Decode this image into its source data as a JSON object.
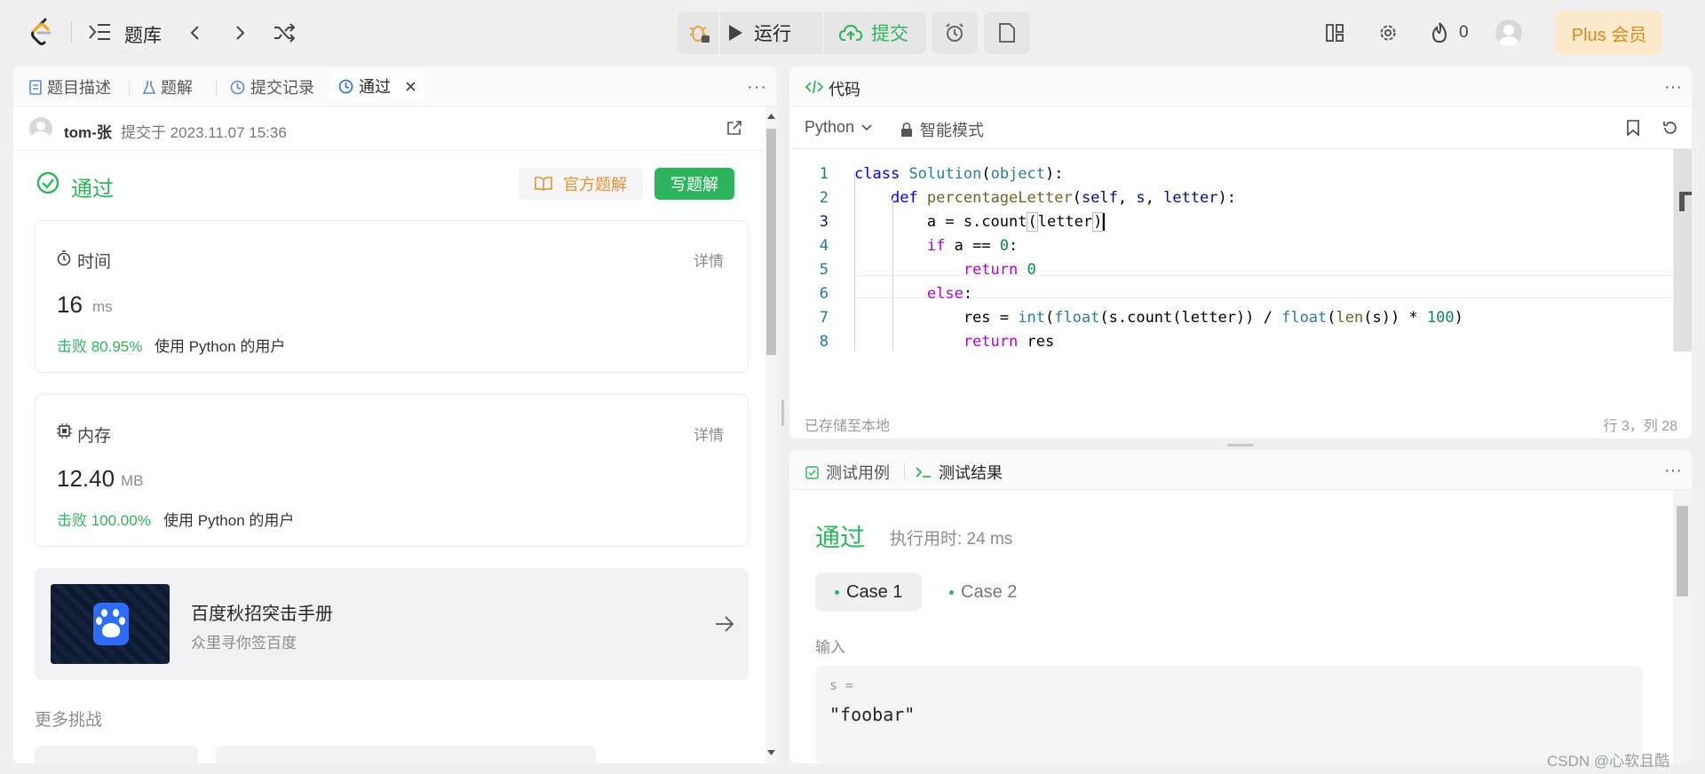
{
  "topbar": {
    "problem_bank": "题库",
    "run_label": "运行",
    "submit_label": "提交",
    "fire_count": "0",
    "plus_label": "Plus 会员"
  },
  "left_tabs": {
    "description": "题目描述",
    "solutions": "题解",
    "submissions": "提交记录",
    "passed": "通过"
  },
  "submission": {
    "user": "tom-张",
    "submitted_at": "提交于 2023.11.07 15:36",
    "status": "通过",
    "official_solution": "官方题解",
    "write_solution": "写题解"
  },
  "runtime": {
    "title": "时间",
    "detail": "详情",
    "value": "16",
    "unit": "ms",
    "beats": "击败 80.95%",
    "beats_suffix": "使用 Python 的用户"
  },
  "memory": {
    "title": "内存",
    "detail": "详情",
    "value": "12.40",
    "unit": "MB",
    "beats": "击败 100.00%",
    "beats_suffix": "使用 Python 的用户"
  },
  "promo": {
    "title": "百度秋招突击手册",
    "subtitle": "众里寻你签百度"
  },
  "more_challenges": "更多挑战",
  "code_panel": {
    "title": "代码",
    "language": "Python",
    "mode": "智能模式",
    "saved": "已存储至本地",
    "cursor": "行 3，列 28"
  },
  "code_lines": [
    "1",
    "2",
    "3",
    "4",
    "5",
    "6",
    "7",
    "8"
  ],
  "result_panel": {
    "tab_testcase": "测试用例",
    "tab_result": "测试结果",
    "status": "通过",
    "exec_time": "执行用时: 24 ms",
    "case1": "Case 1",
    "case2": "Case 2",
    "input_label": "输入",
    "var_label": "s =",
    "var_value": "\"foobar\""
  },
  "watermark": "CSDN @心软且酷",
  "colors": {
    "accent_green": "#2db55d",
    "submit_green": "#2db55d",
    "plus_bg": "#fde9cc",
    "plus_text": "#d98a1c"
  }
}
